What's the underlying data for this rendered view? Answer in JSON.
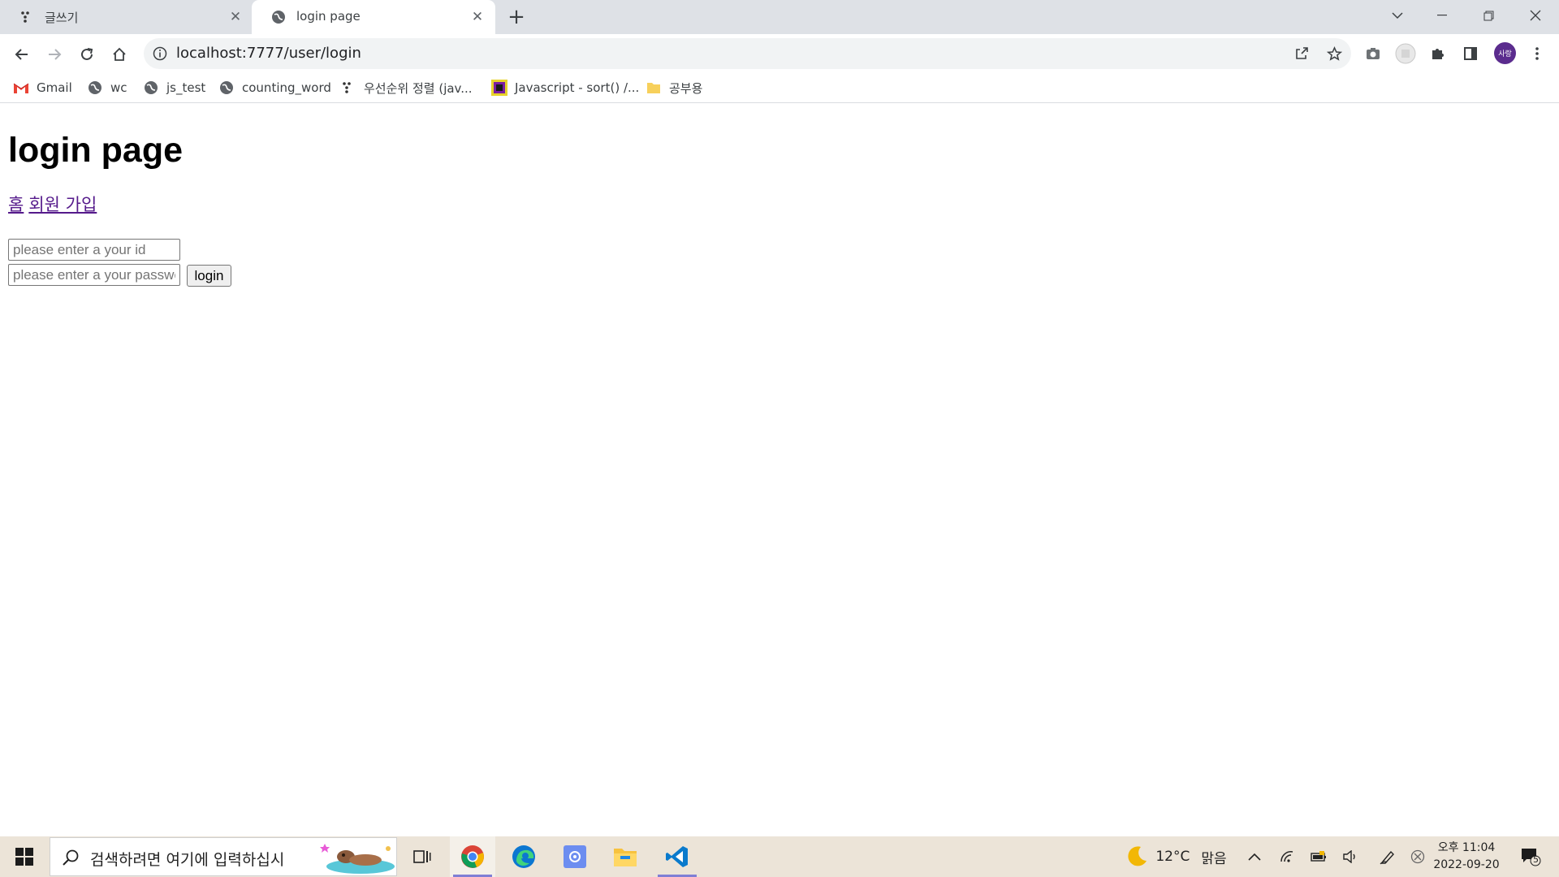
{
  "browser": {
    "tabs": [
      {
        "title": "글쓰기",
        "active": false
      },
      {
        "title": "login page",
        "active": true
      }
    ],
    "url": "localhost:7777/user/login",
    "profile_initials": "사랑",
    "bookmarks": [
      {
        "label": "Gmail",
        "icon": "gmail-icon"
      },
      {
        "label": "wc",
        "icon": "globe-icon"
      },
      {
        "label": "js_test",
        "icon": "globe-icon"
      },
      {
        "label": "counting_word",
        "icon": "globe-icon"
      },
      {
        "label": "우선순위 정렬 (jav...",
        "icon": "velog-icon"
      },
      {
        "label": "Javascript - sort() /...",
        "icon": "site-icon"
      },
      {
        "label": "공부용",
        "icon": "folder-icon"
      }
    ]
  },
  "page": {
    "title": "login page",
    "links": [
      {
        "label": "홈"
      },
      {
        "label": "회원 가입"
      }
    ],
    "form": {
      "id_placeholder": "please enter a your id",
      "password_placeholder": "please enter a your password",
      "login_label": "login"
    }
  },
  "taskbar": {
    "search_placeholder": "검색하려면 여기에 입력하십시",
    "weather": {
      "temp": "12°C",
      "desc": "맑음"
    },
    "time": "오후 11:04",
    "date": "2022-09-20",
    "notifications": "5"
  }
}
